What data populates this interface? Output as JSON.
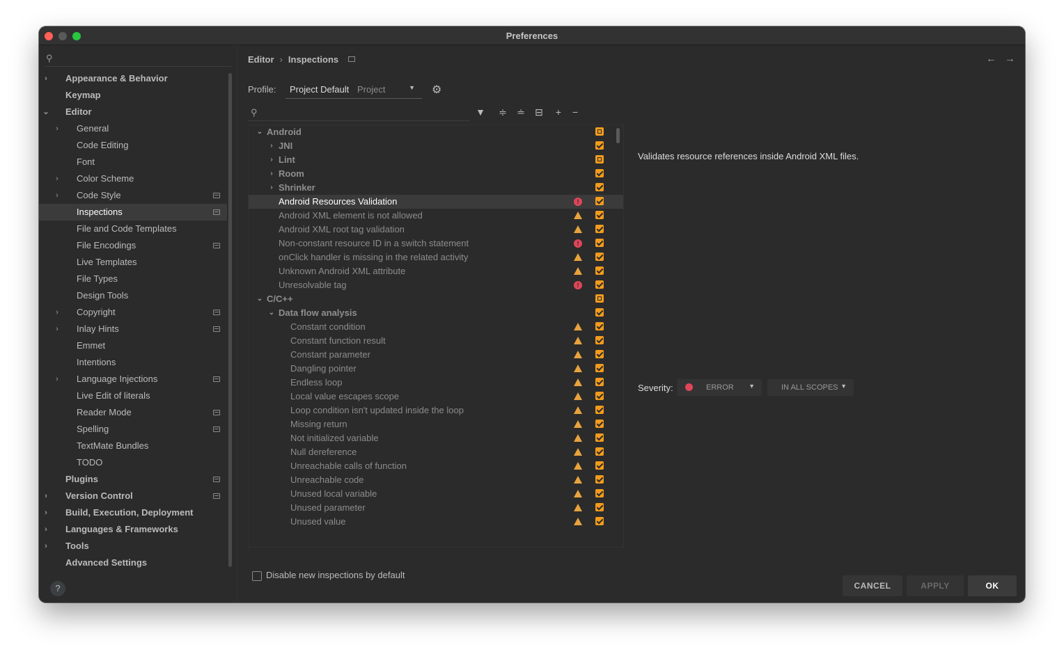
{
  "window": {
    "title": "Preferences"
  },
  "sidebar": {
    "search_placeholder": "",
    "items": [
      {
        "label": "Appearance & Behavior",
        "level": 0,
        "arrow": "›",
        "bold": true,
        "pi": false
      },
      {
        "label": "Keymap",
        "level": 0,
        "arrow": "",
        "bold": true,
        "pi": false
      },
      {
        "label": "Editor",
        "level": 0,
        "arrow": "⌄",
        "bold": true,
        "pi": false
      },
      {
        "label": "General",
        "level": 1,
        "arrow": "›",
        "bold": false,
        "pi": false
      },
      {
        "label": "Code Editing",
        "level": 1,
        "arrow": "",
        "bold": false,
        "pi": false
      },
      {
        "label": "Font",
        "level": 1,
        "arrow": "",
        "bold": false,
        "pi": false
      },
      {
        "label": "Color Scheme",
        "level": 1,
        "arrow": "›",
        "bold": false,
        "pi": false
      },
      {
        "label": "Code Style",
        "level": 1,
        "arrow": "›",
        "bold": false,
        "pi": true
      },
      {
        "label": "Inspections",
        "level": 1,
        "arrow": "",
        "bold": false,
        "pi": true,
        "selected": true
      },
      {
        "label": "File and Code Templates",
        "level": 1,
        "arrow": "",
        "bold": false,
        "pi": false
      },
      {
        "label": "File Encodings",
        "level": 1,
        "arrow": "",
        "bold": false,
        "pi": true
      },
      {
        "label": "Live Templates",
        "level": 1,
        "arrow": "",
        "bold": false,
        "pi": false
      },
      {
        "label": "File Types",
        "level": 1,
        "arrow": "",
        "bold": false,
        "pi": false
      },
      {
        "label": "Design Tools",
        "level": 1,
        "arrow": "",
        "bold": false,
        "pi": false
      },
      {
        "label": "Copyright",
        "level": 1,
        "arrow": "›",
        "bold": false,
        "pi": true
      },
      {
        "label": "Inlay Hints",
        "level": 1,
        "arrow": "›",
        "bold": false,
        "pi": true
      },
      {
        "label": "Emmet",
        "level": 1,
        "arrow": "",
        "bold": false,
        "pi": false
      },
      {
        "label": "Intentions",
        "level": 1,
        "arrow": "",
        "bold": false,
        "pi": false
      },
      {
        "label": "Language Injections",
        "level": 1,
        "arrow": "›",
        "bold": false,
        "pi": true
      },
      {
        "label": "Live Edit of literals",
        "level": 1,
        "arrow": "",
        "bold": false,
        "pi": false
      },
      {
        "label": "Reader Mode",
        "level": 1,
        "arrow": "",
        "bold": false,
        "pi": true
      },
      {
        "label": "Spelling",
        "level": 1,
        "arrow": "",
        "bold": false,
        "pi": true
      },
      {
        "label": "TextMate Bundles",
        "level": 1,
        "arrow": "",
        "bold": false,
        "pi": false
      },
      {
        "label": "TODO",
        "level": 1,
        "arrow": "",
        "bold": false,
        "pi": false
      },
      {
        "label": "Plugins",
        "level": 0,
        "arrow": "",
        "bold": true,
        "pi": true
      },
      {
        "label": "Version Control",
        "level": 0,
        "arrow": "›",
        "bold": true,
        "pi": true
      },
      {
        "label": "Build, Execution, Deployment",
        "level": 0,
        "arrow": "›",
        "bold": true,
        "pi": false
      },
      {
        "label": "Languages & Frameworks",
        "level": 0,
        "arrow": "›",
        "bold": true,
        "pi": false
      },
      {
        "label": "Tools",
        "level": 0,
        "arrow": "›",
        "bold": true,
        "pi": false
      },
      {
        "label": "Advanced Settings",
        "level": 0,
        "arrow": "",
        "bold": true,
        "pi": false
      }
    ],
    "help_label": "?"
  },
  "breadcrumb": {
    "parent": "Editor",
    "current": "Inspections"
  },
  "profile": {
    "label": "Profile:",
    "name": "Project Default",
    "scope": "Project"
  },
  "inspections": {
    "search_placeholder": "",
    "rows": [
      {
        "label": "Android",
        "level": 0,
        "arrow": "⌄",
        "group": true,
        "severity": "",
        "check": "partial"
      },
      {
        "label": "JNI",
        "level": 1,
        "arrow": "›",
        "group": true,
        "severity": "",
        "check": "checked"
      },
      {
        "label": "Lint",
        "level": 1,
        "arrow": "›",
        "group": true,
        "severity": "",
        "check": "partial"
      },
      {
        "label": "Room",
        "level": 1,
        "arrow": "›",
        "group": true,
        "severity": "",
        "check": "checked"
      },
      {
        "label": "Shrinker",
        "level": 1,
        "arrow": "›",
        "group": true,
        "severity": "",
        "check": "checked"
      },
      {
        "label": "Android Resources Validation",
        "level": 1,
        "arrow": "",
        "group": false,
        "severity": "error",
        "check": "checked",
        "selected": true
      },
      {
        "label": "Android XML element is not allowed",
        "level": 1,
        "arrow": "",
        "group": false,
        "severity": "warning",
        "check": "checked"
      },
      {
        "label": "Android XML root tag validation",
        "level": 1,
        "arrow": "",
        "group": false,
        "severity": "warning",
        "check": "checked"
      },
      {
        "label": "Non-constant resource ID in a switch statement",
        "level": 1,
        "arrow": "",
        "group": false,
        "severity": "error",
        "check": "checked"
      },
      {
        "label": "onClick handler is missing in the related activity",
        "level": 1,
        "arrow": "",
        "group": false,
        "severity": "warning",
        "check": "checked"
      },
      {
        "label": "Unknown Android XML attribute",
        "level": 1,
        "arrow": "",
        "group": false,
        "severity": "warning",
        "check": "checked"
      },
      {
        "label": "Unresolvable tag",
        "level": 1,
        "arrow": "",
        "group": false,
        "severity": "error",
        "check": "checked"
      },
      {
        "label": "C/C++",
        "level": 0,
        "arrow": "⌄",
        "group": true,
        "severity": "",
        "check": "partial"
      },
      {
        "label": "Data flow analysis",
        "level": 1,
        "arrow": "⌄",
        "group": true,
        "severity": "",
        "check": "checked"
      },
      {
        "label": "Constant condition",
        "level": 2,
        "arrow": "",
        "group": false,
        "severity": "warning",
        "check": "checked"
      },
      {
        "label": "Constant function result",
        "level": 2,
        "arrow": "",
        "group": false,
        "severity": "warning",
        "check": "checked"
      },
      {
        "label": "Constant parameter",
        "level": 2,
        "arrow": "",
        "group": false,
        "severity": "warning",
        "check": "checked"
      },
      {
        "label": "Dangling pointer",
        "level": 2,
        "arrow": "",
        "group": false,
        "severity": "warning",
        "check": "checked"
      },
      {
        "label": "Endless loop",
        "level": 2,
        "arrow": "",
        "group": false,
        "severity": "warning",
        "check": "checked"
      },
      {
        "label": "Local value escapes scope",
        "level": 2,
        "arrow": "",
        "group": false,
        "severity": "warning",
        "check": "checked"
      },
      {
        "label": "Loop condition isn't updated inside the loop",
        "level": 2,
        "arrow": "",
        "group": false,
        "severity": "warning",
        "check": "checked"
      },
      {
        "label": "Missing return",
        "level": 2,
        "arrow": "",
        "group": false,
        "severity": "warning",
        "check": "checked"
      },
      {
        "label": "Not initialized variable",
        "level": 2,
        "arrow": "",
        "group": false,
        "severity": "warning",
        "check": "checked"
      },
      {
        "label": "Null dereference",
        "level": 2,
        "arrow": "",
        "group": false,
        "severity": "warning",
        "check": "checked"
      },
      {
        "label": "Unreachable calls of function",
        "level": 2,
        "arrow": "",
        "group": false,
        "severity": "warning",
        "check": "checked"
      },
      {
        "label": "Unreachable code",
        "level": 2,
        "arrow": "",
        "group": false,
        "severity": "warning",
        "check": "checked"
      },
      {
        "label": "Unused local variable",
        "level": 2,
        "arrow": "",
        "group": false,
        "severity": "warning",
        "check": "checked"
      },
      {
        "label": "Unused parameter",
        "level": 2,
        "arrow": "",
        "group": false,
        "severity": "warning",
        "check": "checked"
      },
      {
        "label": "Unused value",
        "level": 2,
        "arrow": "",
        "group": false,
        "severity": "warning",
        "check": "checked"
      }
    ],
    "disable_new_label": "Disable new inspections by default"
  },
  "details": {
    "description": "Validates resource references inside Android XML files.",
    "severity_label": "Severity:",
    "severity_value": "ERROR",
    "scope_value": "IN ALL SCOPES"
  },
  "buttons": {
    "cancel": "CANCEL",
    "apply": "APPLY",
    "ok": "OK"
  },
  "colors": {
    "accent": "#f29b1d",
    "error": "#e0455a",
    "warning": "#e8a33d",
    "background": "#2b2b2b"
  }
}
